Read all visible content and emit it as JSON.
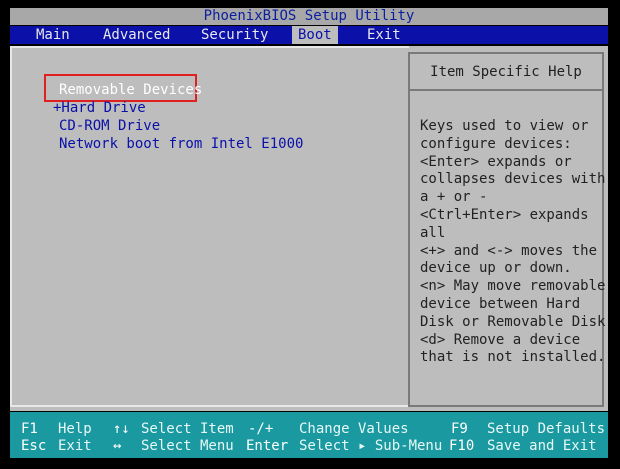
{
  "title": "PhoenixBIOS Setup Utility",
  "menu": {
    "tabs": [
      "Main",
      "Advanced",
      "Security",
      "Boot",
      "Exit"
    ],
    "active": "Boot"
  },
  "boot_list": {
    "items": [
      "Removable Devices",
      "+Hard Drive",
      "CD-ROM Drive",
      "Network boot from Intel E1000"
    ],
    "selected_index": 0
  },
  "help": {
    "heading": "Item Specific Help",
    "lines": [
      "Keys used to view or",
      "configure devices:",
      "<Enter> expands or",
      "collapses devices with",
      "a + or -",
      "<Ctrl+Enter> expands",
      "all",
      "<+> and <-> moves the",
      "device up or down.",
      "<n> May move removable",
      "device between Hard",
      "Disk or Removable Disk",
      "<d> Remove a device",
      "that is not installed."
    ]
  },
  "keybar": {
    "row1": [
      {
        "key": "F1",
        "label": "Help"
      },
      {
        "key": "↑↓",
        "label": "Select Item"
      },
      {
        "key": "-/+",
        "label": "Change Values"
      },
      {
        "key": "F9",
        "label": "Setup Defaults"
      }
    ],
    "row2": [
      {
        "key": "Esc",
        "label": "Exit"
      },
      {
        "key": "↔",
        "label": "Select Menu"
      },
      {
        "key": "Enter",
        "label": "Select ▸ Sub-Menu"
      },
      {
        "key": "F10",
        "label": "Save and Exit"
      }
    ]
  },
  "colors": {
    "bios_blue": "#0a10a8",
    "panel_gray": "#bdbdbd",
    "keybar_teal": "#1a9aa0",
    "highlight_red": "#e02020"
  }
}
